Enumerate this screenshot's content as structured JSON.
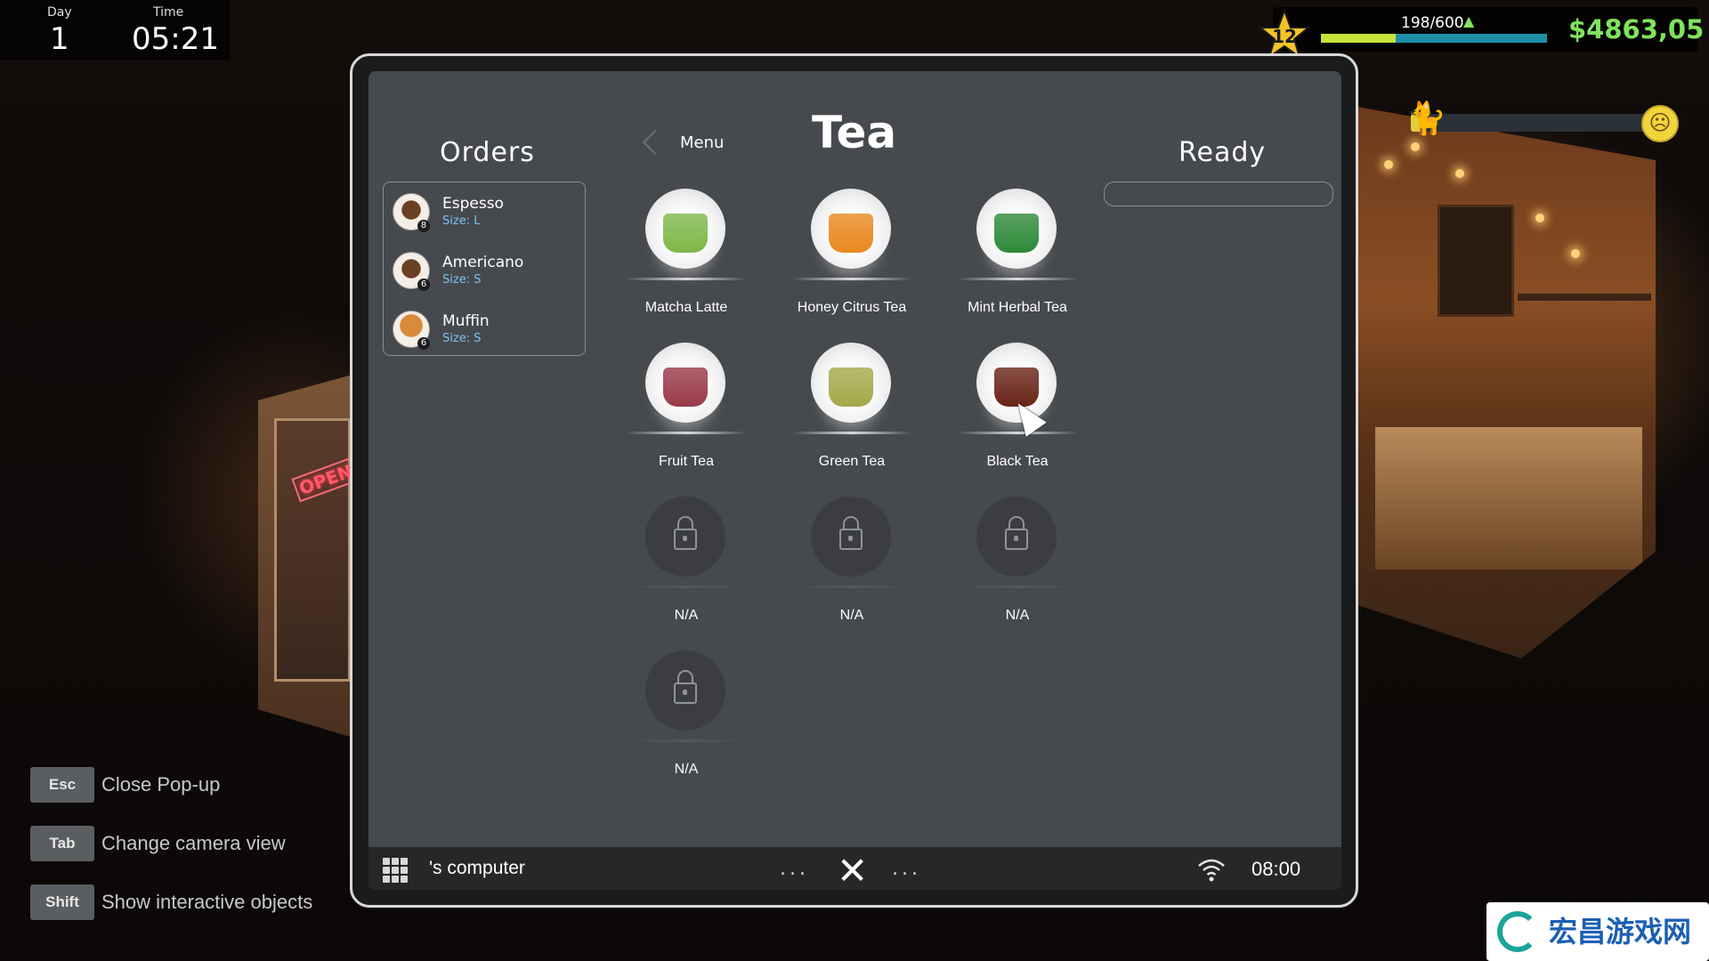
{
  "hud": {
    "day_label": "Day",
    "day_value": "1",
    "time_label": "Time",
    "time_value": "05:21",
    "level": "12",
    "xp_text": "198/600",
    "xp_progress": 0.33,
    "money": "$4863,05",
    "customer_mood": 0.05
  },
  "hints": [
    {
      "key": "Esc",
      "text": "Close Pop-up"
    },
    {
      "key": "Tab",
      "text": "Change camera view"
    },
    {
      "key": "Shift",
      "text": "Show interactive objects"
    }
  ],
  "tablet": {
    "orders_title": "Orders",
    "orders": [
      {
        "name": "Espesso",
        "size": "Size: L",
        "count": "8",
        "icon": "coffee-cup-icon"
      },
      {
        "name": "Americano",
        "size": "Size: S",
        "count": "6",
        "icon": "coffee-cup-icon"
      },
      {
        "name": "Muffin",
        "size": "Size: S",
        "count": "6",
        "icon": "muffin-icon"
      }
    ],
    "back_label": "Menu",
    "category_title": "Tea",
    "ready_title": "Ready",
    "items": [
      {
        "name": "Matcha Latte",
        "color": "#7fb84a"
      },
      {
        "name": "Honey Citrus Tea",
        "color": "#e8891f"
      },
      {
        "name": "Mint Herbal Tea",
        "color": "#2f8a3a"
      },
      {
        "name": "Fruit Tea",
        "color": "#9a3a4a"
      },
      {
        "name": "Green Tea",
        "color": "#a6a84a"
      },
      {
        "name": "Black Tea",
        "color": "#6a2418"
      },
      {
        "name": "N/A",
        "locked": true
      },
      {
        "name": "N/A",
        "locked": true
      },
      {
        "name": "N/A",
        "locked": true
      },
      {
        "name": "N/A",
        "locked": true
      }
    ]
  },
  "taskbar": {
    "owner": "'s computer",
    "dots_left": "...",
    "dots_right": "...",
    "time": "08:00"
  },
  "watermark": {
    "text": "宏昌游戏网"
  }
}
